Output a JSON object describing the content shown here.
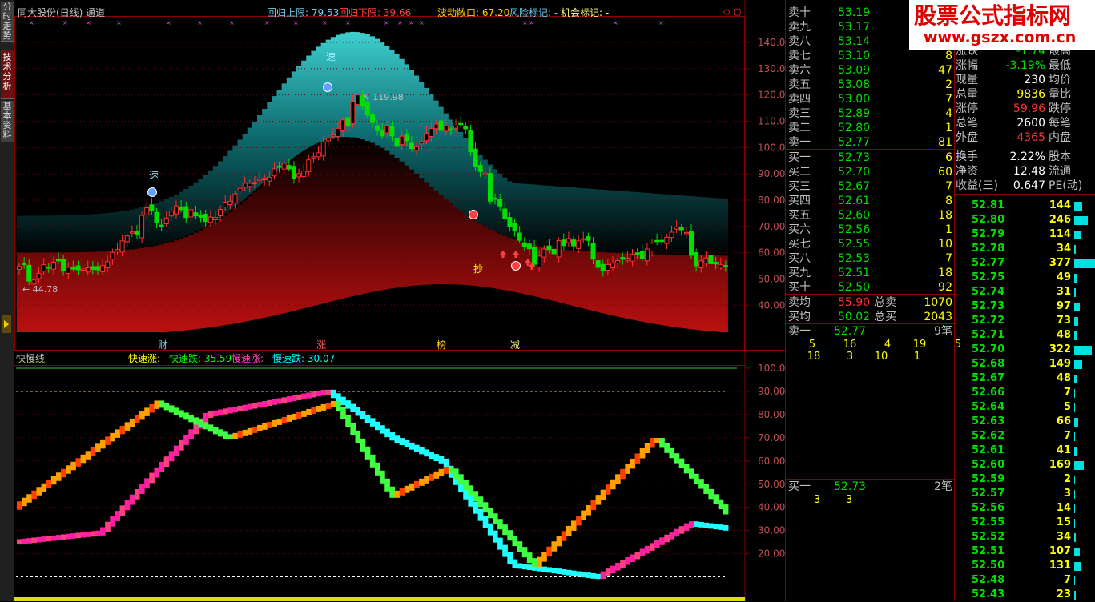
{
  "sidebar": {
    "tabs": [
      "分时走势",
      "技术分析",
      "基本资料"
    ]
  },
  "main": {
    "header": {
      "title": "同大股份(日线) 通道",
      "upper_label": "回归上限: 79.53",
      "lower_label": "回归下限: 39.66",
      "wave_label": "波动敞口: 67.20",
      "risk_label": "风险标记: -",
      "opportunity_label": "机会标记: -",
      "colors": {
        "upper": "#6ec8e8",
        "lower": "#ff4040",
        "wave": "#ffcc00",
        "risk": "#6ec8e8",
        "opportunity": "#ffff80"
      }
    },
    "price_axis": [
      "140.0",
      "130.0",
      "120.0",
      "110.0",
      "100.0",
      "90.00",
      "80.00",
      "70.00",
      "60.00",
      "50.00",
      "40.00"
    ],
    "high_mark": "119.98",
    "low_mark": "44.78",
    "markers": {
      "su1": "速",
      "su2": "速",
      "chao": "抄",
      "cai": "财",
      "zhang": "涨",
      "bang": "榜",
      "jian": "减"
    },
    "candles": [
      54.7,
      55.5,
      49.2,
      49.6,
      52.1,
      55.4,
      54.5,
      56.4,
      56.9,
      53.3,
      54.4,
      53.8,
      53.5,
      53.8,
      54.3,
      53.7,
      53.5,
      55.1,
      56.6,
      60.1,
      61.3,
      64.5,
      66.4,
      67.9,
      66.9,
      74.2,
      77.1,
      75.9,
      71.5,
      70.2,
      73.2,
      75.8,
      77.8,
      76.4,
      73.4,
      76.4,
      74.0,
      73.5,
      71.9,
      73.6,
      73.4,
      76.5,
      79.2,
      79.6,
      82.4,
      84.5,
      86.4,
      86.4,
      86.7,
      88.0,
      88.4,
      88.7,
      91.9,
      92.6,
      94.0,
      91.9,
      88.3,
      90.1,
      91.1,
      95.3,
      96.5,
      98.0,
      102.2,
      103.5,
      104.8,
      107.3,
      110.5,
      108.4,
      117.4,
      120.0,
      116.1,
      112.3,
      109.5,
      106.4,
      104.4,
      108.4,
      104.4,
      100.4,
      104.3,
      102.6,
      99.6,
      100.3,
      102.3,
      105.4,
      107.2,
      108.9,
      106.5,
      108.2,
      106.8,
      108.2,
      109.0,
      107.1,
      98.4,
      92.7,
      90.9,
      90.3,
      79.6,
      80.5,
      77.8,
      73.0,
      70.1,
      68.2,
      64.7,
      62.4,
      61.5,
      55.6,
      58.7,
      61.4,
      61.2,
      59.6,
      64.6,
      62.7,
      65.4,
      62.6,
      64.5,
      65.3,
      64.7,
      57.5,
      54.4,
      53.1,
      55.5,
      56.0,
      57.0,
      57.5,
      57.9,
      59.3,
      59.5,
      57.8,
      61.4,
      63.6,
      64.3,
      64.7,
      65.9,
      67.8,
      69.8,
      68.7,
      67.7,
      59.0,
      55.0,
      56.9,
      58.0,
      55.8,
      55.7,
      55.4,
      54.8
    ],
    "upper_band": [
      null,
      null,
      null,
      null,
      null,
      null,
      null,
      null,
      null,
      null,
      null,
      null,
      null,
      null,
      null,
      null,
      null,
      null,
      null,
      null,
      null,
      null,
      null,
      null,
      null,
      null,
      null,
      null,
      null,
      null,
      null,
      null,
      null,
      null,
      null,
      null,
      null,
      null,
      null,
      null,
      null,
      null,
      null,
      null,
      null,
      null,
      null,
      null,
      null,
      null,
      null,
      null,
      null,
      null,
      null,
      null,
      null,
      null,
      null,
      null,
      null,
      null,
      null,
      null,
      null,
      null,
      null,
      null,
      null,
      null,
      null,
      null,
      null,
      null,
      null,
      null,
      null,
      null,
      null,
      null,
      null,
      null,
      null,
      null,
      null,
      null,
      null,
      null,
      null,
      null,
      null,
      null,
      null,
      null,
      null,
      null,
      null,
      null,
      null,
      null,
      null,
      null,
      null,
      null,
      null,
      null,
      null,
      null,
      null,
      null,
      null,
      null,
      null,
      null,
      null,
      null,
      null,
      null,
      null,
      null,
      null,
      null,
      null,
      null,
      null,
      null,
      null,
      null,
      null,
      null,
      null,
      null,
      null,
      null,
      null,
      null,
      null,
      null,
      null,
      null,
      null,
      null,
      null,
      null,
      null,
      null
    ]
  },
  "indicator": {
    "title": "快慢线",
    "fast_up_label": "快速涨: -",
    "fast_down_label": "快速跌: 35.59",
    "slow_up_label": "慢速涨: -",
    "slow_down_label": "慢速跌: 30.07",
    "colors": {
      "fast_up": "#ffff00",
      "fast_down": "#00ff00",
      "slow_up": "#ff40c0",
      "slow_down": "#00ffff"
    },
    "axis": [
      "100.0",
      "90.00",
      "80.00",
      "70.00",
      "60.00",
      "50.00",
      "40.00",
      "30.00",
      "20.00"
    ]
  },
  "quote": {
    "sell": [
      {
        "label": "卖十",
        "price": "53.19",
        "vol": ""
      },
      {
        "label": "卖九",
        "price": "53.17",
        "vol": ""
      },
      {
        "label": "卖八",
        "price": "53.14",
        "vol": ""
      },
      {
        "label": "卖七",
        "price": "53.10",
        "vol": "8"
      },
      {
        "label": "卖六",
        "price": "53.09",
        "vol": "47"
      },
      {
        "label": "卖五",
        "price": "53.08",
        "vol": "2"
      },
      {
        "label": "卖四",
        "price": "53.00",
        "vol": "7"
      },
      {
        "label": "卖三",
        "price": "52.89",
        "vol": "4"
      },
      {
        "label": "卖二",
        "price": "52.80",
        "vol": "1"
      },
      {
        "label": "卖一",
        "price": "52.77",
        "vol": "81"
      }
    ],
    "buy": [
      {
        "label": "买一",
        "price": "52.73",
        "vol": "6"
      },
      {
        "label": "买二",
        "price": "52.70",
        "vol": "60"
      },
      {
        "label": "买三",
        "price": "52.67",
        "vol": "7"
      },
      {
        "label": "买四",
        "price": "52.61",
        "vol": "8"
      },
      {
        "label": "买五",
        "price": "52.60",
        "vol": "18"
      },
      {
        "label": "买六",
        "price": "52.56",
        "vol": "1"
      },
      {
        "label": "买七",
        "price": "52.55",
        "vol": "10"
      },
      {
        "label": "买八",
        "price": "52.53",
        "vol": "7"
      },
      {
        "label": "买九",
        "price": "52.51",
        "vol": "18"
      },
      {
        "label": "买十",
        "price": "52.50",
        "vol": "92"
      }
    ],
    "sell_avg": {
      "label": "卖均",
      "value": "55.90",
      "total_label": "总卖",
      "total": "1070"
    },
    "buy_avg": {
      "label": "买均",
      "value": "50.02",
      "total_label": "总买",
      "total": "2043"
    },
    "queue_sell": {
      "label": "卖一",
      "price": "52.77",
      "count": "9笔",
      "row1": [
        "5",
        "16",
        "4",
        "19",
        "5"
      ],
      "row2": [
        "18",
        "3",
        "10",
        "1"
      ]
    },
    "queue_buy": {
      "label": "买一",
      "price": "52.73",
      "count": "2笔",
      "row1": [
        "3",
        "3"
      ]
    },
    "stats": [
      {
        "l": "涨跌",
        "v": "-1.74",
        "l2": "最高",
        "c": "#00e000"
      },
      {
        "l": "涨幅",
        "v": "-3.19%",
        "l2": "最低",
        "c": "#00e000"
      },
      {
        "l": "现量",
        "v": "230",
        "l2": "均价",
        "c": "#ffffff"
      },
      {
        "l": "总量",
        "v": "9836",
        "l2": "量比",
        "c": "#ffff00"
      },
      {
        "l": "涨停",
        "v": "59.96",
        "l2": "跌停",
        "c": "#ff3030"
      },
      {
        "l": "总笔",
        "v": "2600",
        "l2": "每笔",
        "c": "#ffffff"
      },
      {
        "l": "外盘",
        "v": "4365",
        "l2": "内盘",
        "c": "#ff3030"
      },
      {
        "l": "换手",
        "v": "2.22%",
        "l2": "股本",
        "c": "#ffffff"
      },
      {
        "l": "净资",
        "v": "12.48",
        "l2": "流通",
        "c": "#ffffff"
      },
      {
        "l": "收益(三)",
        "v": "0.647",
        "l2": "PE(动)",
        "c": "#ffffff"
      }
    ],
    "ticks": [
      {
        "p": "52.81",
        "v": "144"
      },
      {
        "p": "52.80",
        "v": "246"
      },
      {
        "p": "52.79",
        "v": "114"
      },
      {
        "p": "52.78",
        "v": "34"
      },
      {
        "p": "52.77",
        "v": "377"
      },
      {
        "p": "52.75",
        "v": "49"
      },
      {
        "p": "52.74",
        "v": "31"
      },
      {
        "p": "52.73",
        "v": "97"
      },
      {
        "p": "52.72",
        "v": "73"
      },
      {
        "p": "52.71",
        "v": "48"
      },
      {
        "p": "52.70",
        "v": "322"
      },
      {
        "p": "52.68",
        "v": "149"
      },
      {
        "p": "52.67",
        "v": "48"
      },
      {
        "p": "52.66",
        "v": "7"
      },
      {
        "p": "52.64",
        "v": "5"
      },
      {
        "p": "52.63",
        "v": "66"
      },
      {
        "p": "52.62",
        "v": "7"
      },
      {
        "p": "52.61",
        "v": "41"
      },
      {
        "p": "52.60",
        "v": "169"
      },
      {
        "p": "52.59",
        "v": "2"
      },
      {
        "p": "52.57",
        "v": "3"
      },
      {
        "p": "52.56",
        "v": "14"
      },
      {
        "p": "52.55",
        "v": "15"
      },
      {
        "p": "52.52",
        "v": "34"
      },
      {
        "p": "52.51",
        "v": "107"
      },
      {
        "p": "52.50",
        "v": "131"
      },
      {
        "p": "52.48",
        "v": "7"
      },
      {
        "p": "52.43",
        "v": "23"
      }
    ]
  },
  "logo": {
    "line1": "股票公式指标网",
    "line2": "www.gszx.com.cn"
  }
}
